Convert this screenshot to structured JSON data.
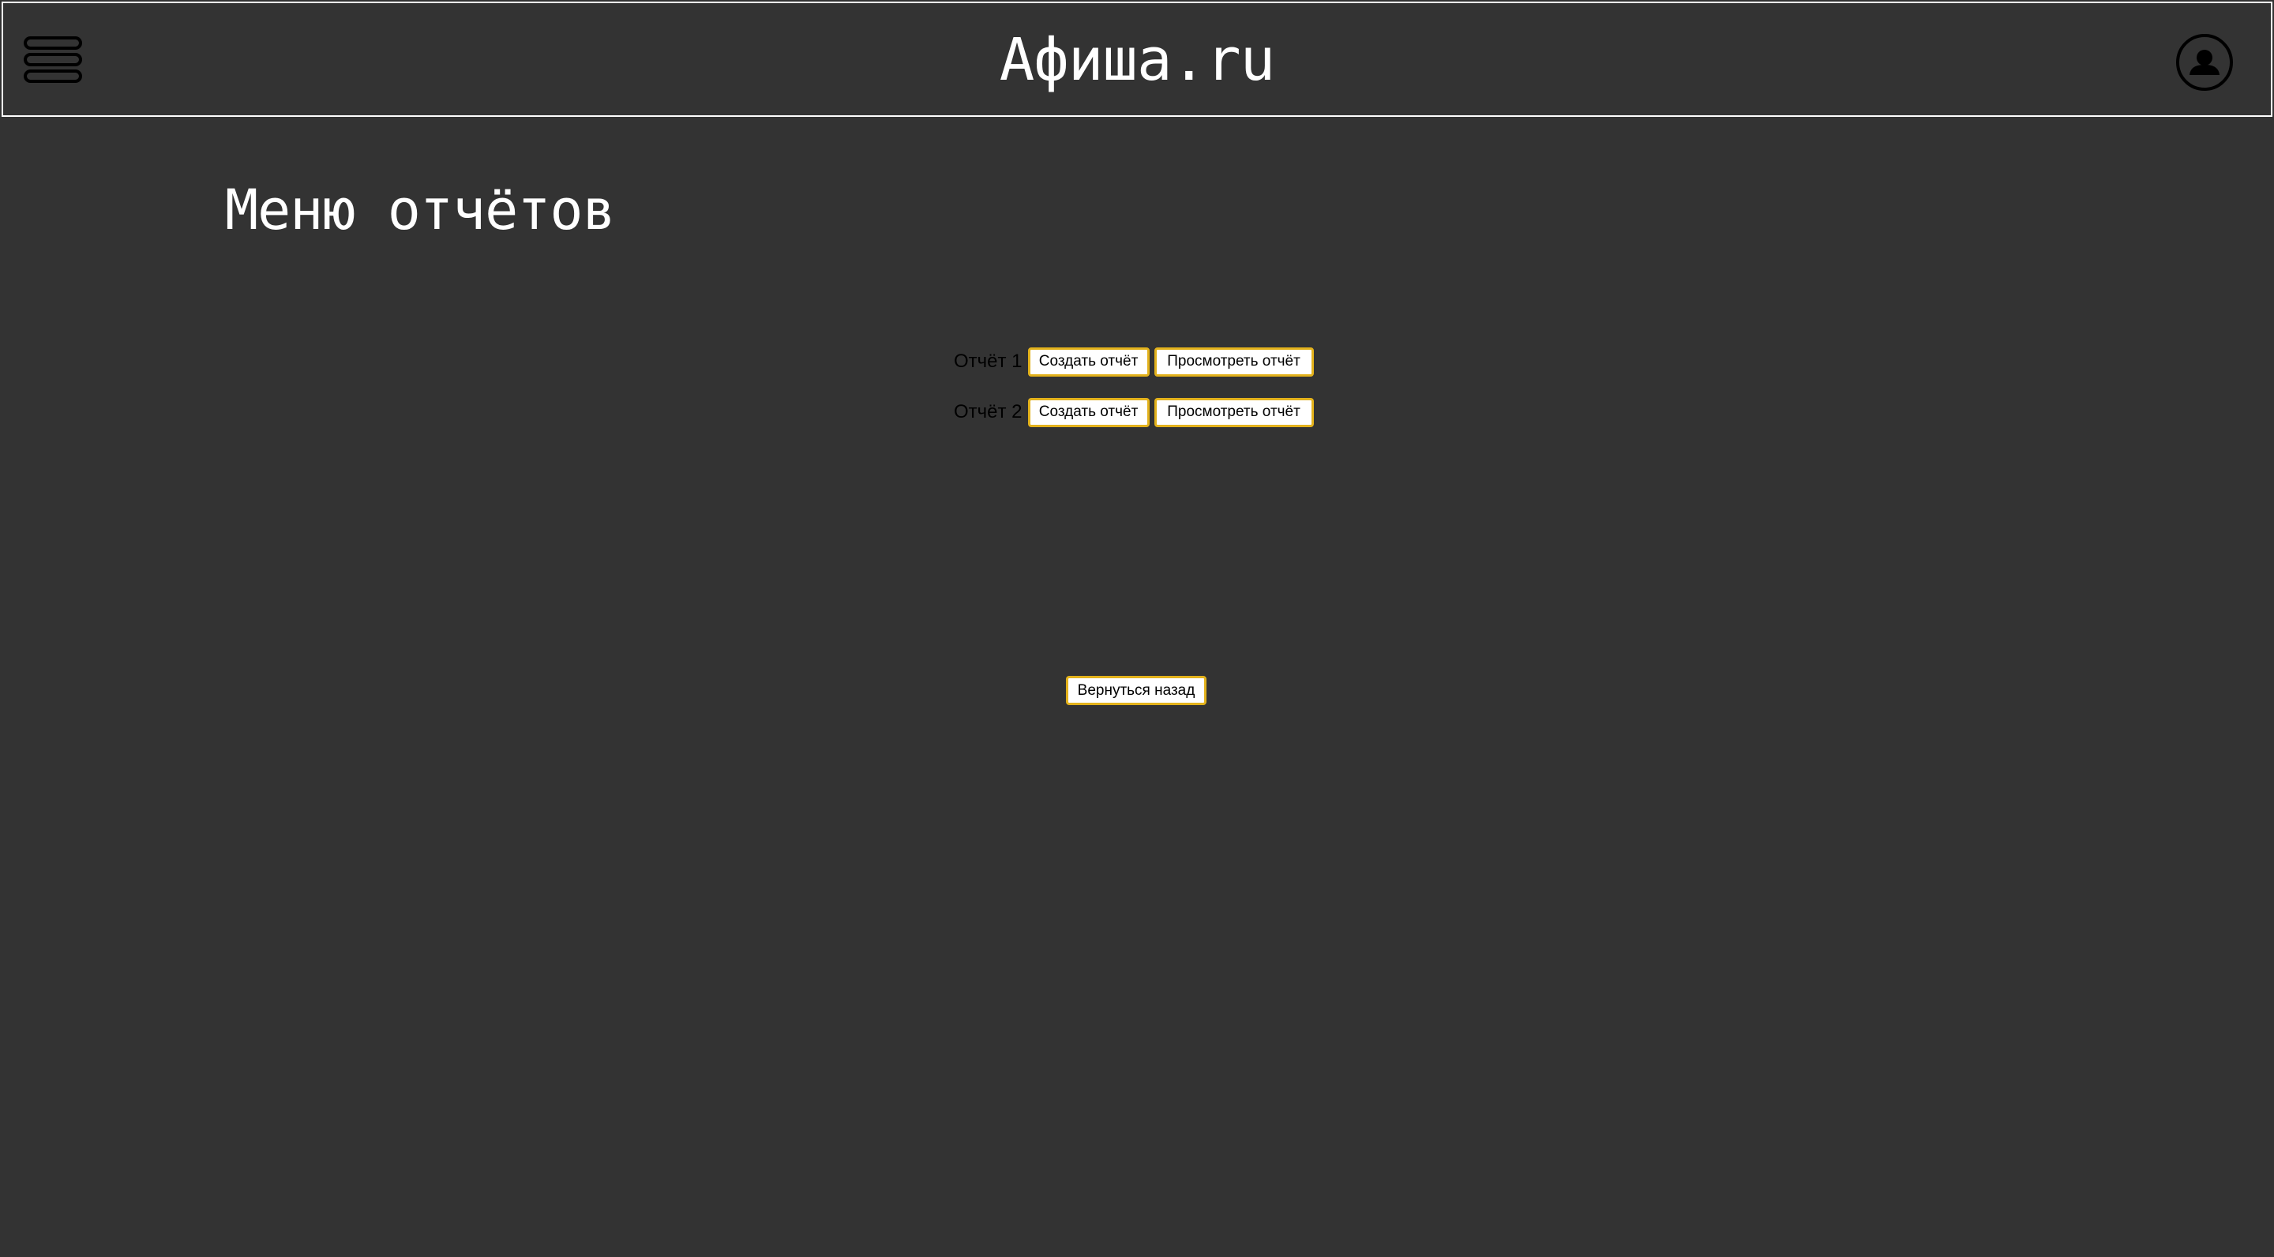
{
  "header": {
    "title": "Афиша.ru",
    "menu_icon": "hamburger-menu-icon",
    "profile_icon": "user-circle-icon"
  },
  "main": {
    "page_title": "Меню отчётов",
    "reports": [
      {
        "label": "Отчёт 1",
        "create_label": "Создать отчёт",
        "view_label": "Просмотреть отчёт"
      },
      {
        "label": "Отчёт 2",
        "create_label": "Создать отчёт",
        "view_label": "Просмотреть отчёт"
      }
    ],
    "back_label": "Вернуться назад"
  },
  "colors": {
    "background": "#333333",
    "header_border": "#ffffff",
    "button_border": "#e3b21c",
    "title_text": "#ffffff"
  }
}
